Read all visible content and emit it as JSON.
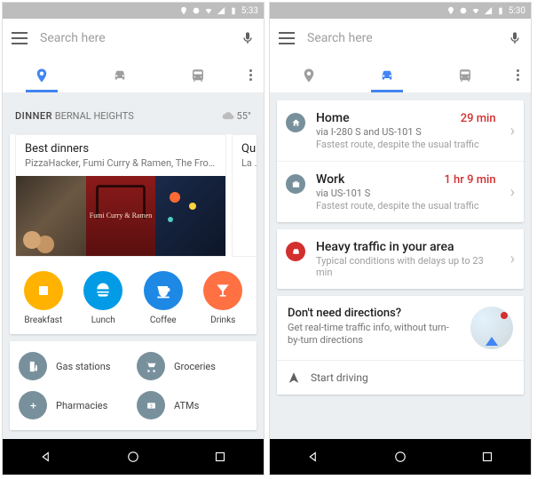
{
  "status": {
    "time_left": "5:33",
    "time_right": "5:30"
  },
  "search": {
    "placeholder": "Search here"
  },
  "left": {
    "header": {
      "category": "DINNER",
      "area": "BERNAL HEIGHTS",
      "temp": "55°"
    },
    "carousel": [
      {
        "title": "Best dinners",
        "sub": "PizzaHacker, Fumi Curry & Ramen, The Front...",
        "overlay": "Fumi\nCurry\n&\nRamen"
      },
      {
        "title": "Quick",
        "sub": "La Alt"
      }
    ],
    "cats": [
      {
        "label": "Breakfast",
        "color": "#ffb300"
      },
      {
        "label": "Lunch",
        "color": "#039be5"
      },
      {
        "label": "Coffee",
        "color": "#1e88e5"
      },
      {
        "label": "Drinks",
        "color": "#ff7043"
      }
    ],
    "services": [
      {
        "label": "Gas stations"
      },
      {
        "label": "Groceries"
      },
      {
        "label": "Pharmacies"
      },
      {
        "label": "ATMs"
      }
    ]
  },
  "right": {
    "dest": [
      {
        "name": "Home",
        "time": "29 min",
        "via": "via I-280 S and US-101 S",
        "note": "Fastest route, despite the usual traffic",
        "icon": "home"
      },
      {
        "name": "Work",
        "time": "1 hr 9 min",
        "via": "via US-101 S",
        "note": "Fastest route, despite the usual traffic",
        "icon": "work"
      }
    ],
    "traffic": {
      "title": "Heavy traffic in your area",
      "sub": "Typical conditions with delays up to 23 min"
    },
    "prompt": {
      "title": "Don't need directions?",
      "sub": "Get real-time traffic info, without turn-by-turn directions"
    },
    "start": "Start driving"
  }
}
